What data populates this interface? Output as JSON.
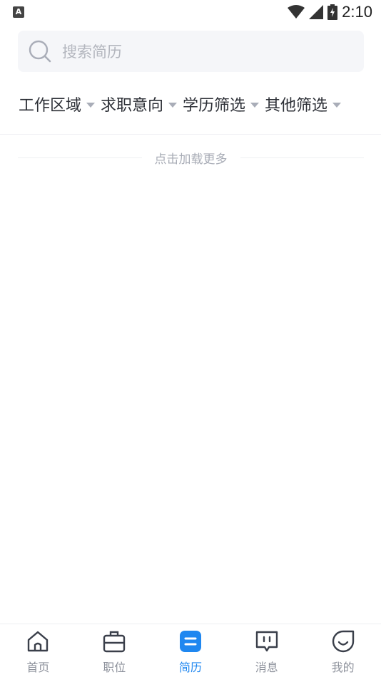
{
  "status_bar": {
    "time": "2:10",
    "notification_letter": "A"
  },
  "search": {
    "placeholder": "搜索简历"
  },
  "filters": [
    {
      "label": "工作区域"
    },
    {
      "label": "求职意向"
    },
    {
      "label": "学历筛选"
    },
    {
      "label": "其他筛选"
    }
  ],
  "list": {
    "load_more": "点击加载更多"
  },
  "tabs": [
    {
      "label": "首页",
      "icon": "home-icon",
      "active": false
    },
    {
      "label": "职位",
      "icon": "briefcase-icon",
      "active": false
    },
    {
      "label": "简历",
      "icon": "resume-icon",
      "active": true
    },
    {
      "label": "消息",
      "icon": "message-icon",
      "active": false
    },
    {
      "label": "我的",
      "icon": "profile-icon",
      "active": false
    }
  ],
  "colors": {
    "accent": "#1f87f0",
    "inactive": "#8e929c",
    "search_bg": "#f5f6f9"
  }
}
